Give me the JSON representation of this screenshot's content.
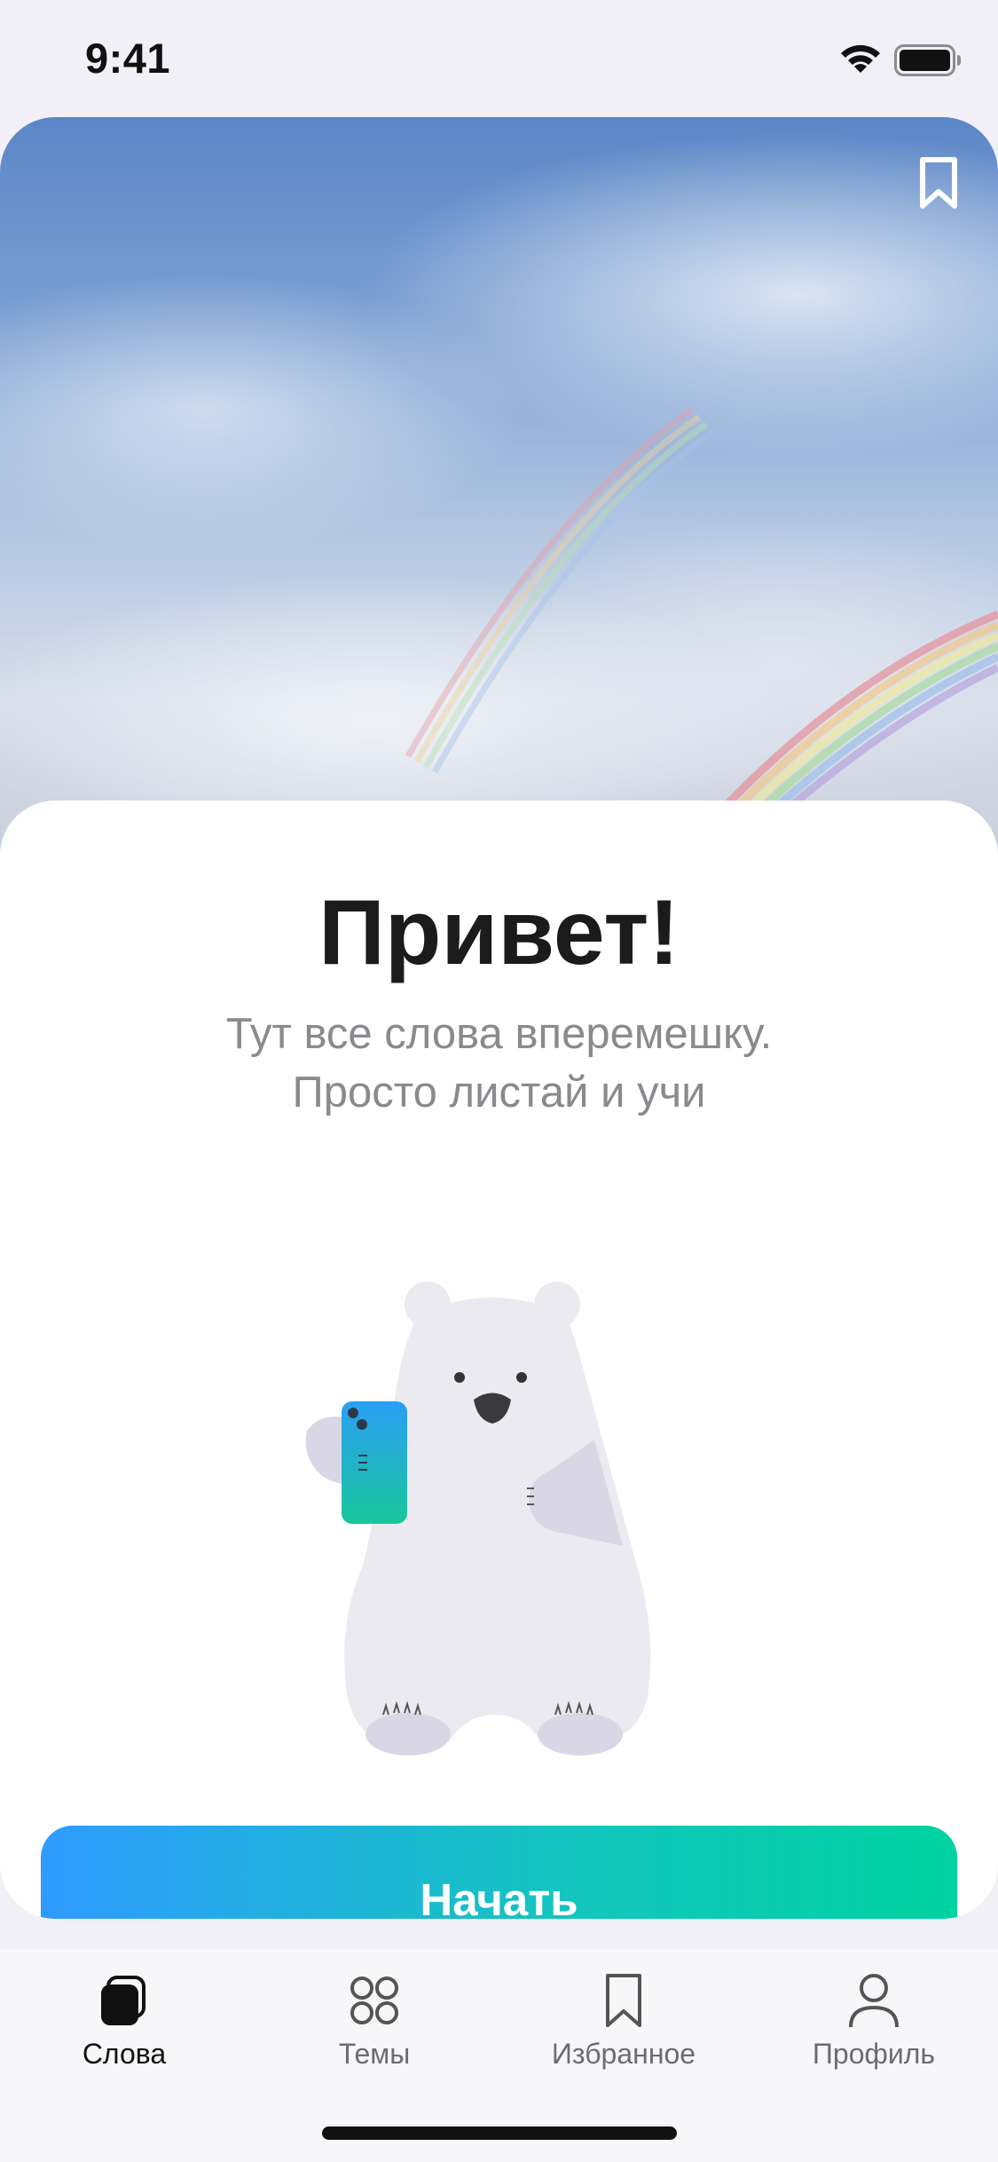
{
  "status_bar": {
    "time": "9:41",
    "wifi_icon": "wifi-icon",
    "battery_icon": "battery-icon"
  },
  "hero": {
    "bookmark_icon": "bookmark-icon",
    "title": "Привет!",
    "subtitle_line1": "Тут все слова вперемешку.",
    "subtitle_line2": "Просто листай и учи",
    "illustration": "polar-bear-with-phone",
    "start_button_label": "Начать"
  },
  "tab_bar": {
    "active": "words",
    "tabs": [
      {
        "id": "words",
        "label": "Слова",
        "icon": "cards-icon"
      },
      {
        "id": "topics",
        "label": "Темы",
        "icon": "grid-circles-icon"
      },
      {
        "id": "favorites",
        "label": "Избранное",
        "icon": "bookmark-icon"
      },
      {
        "id": "profile",
        "label": "Профиль",
        "icon": "person-icon"
      }
    ]
  },
  "colors": {
    "button_gradient_start": "#2f9bff",
    "button_gradient_end": "#00d3a0",
    "background": "#f1f0f6",
    "bear_body": "#ebeaf1",
    "bear_shadow": "#d9d7e6",
    "phone_gradient_start": "#2a9ff5",
    "phone_gradient_end": "#19c79a"
  }
}
